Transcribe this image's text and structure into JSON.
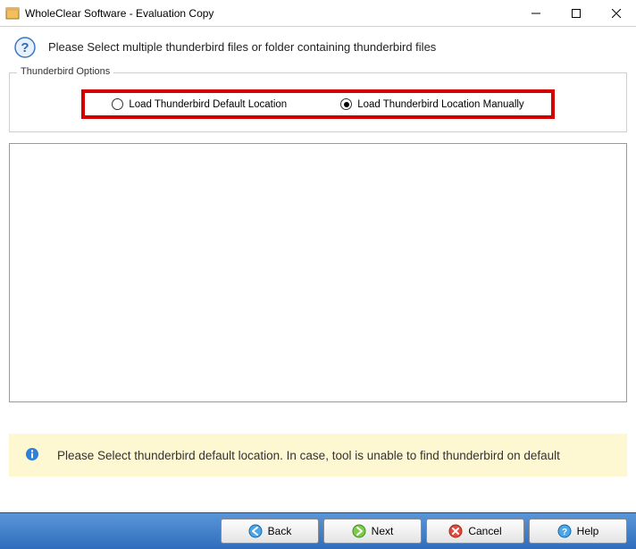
{
  "window": {
    "title": "WholeClear Software - Evaluation Copy"
  },
  "header": {
    "text": "Please Select multiple thunderbird files or folder containing thunderbird files"
  },
  "options": {
    "legend": "Thunderbird Options",
    "radio_default": "Load Thunderbird Default Location",
    "radio_manual": "Load Thunderbird Location Manually",
    "selected": "manual"
  },
  "hint": {
    "text": "Please Select thunderbird default location. In case, tool is unable to find thunderbird on default"
  },
  "footer": {
    "back": "Back",
    "next": "Next",
    "cancel": "Cancel",
    "help": "Help"
  }
}
